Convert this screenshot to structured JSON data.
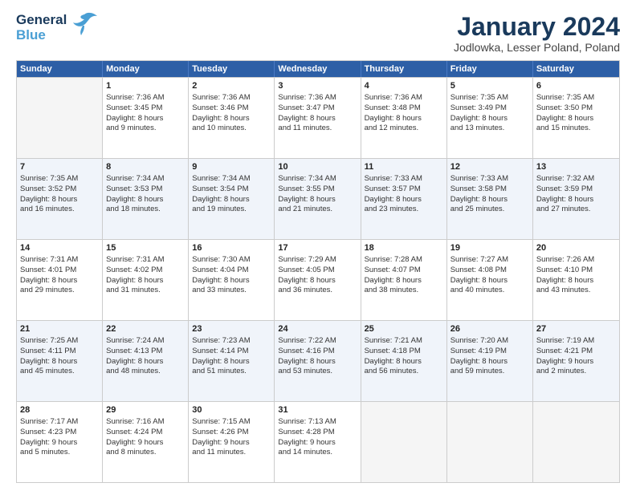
{
  "header": {
    "logo_line1": "General",
    "logo_line2": "Blue",
    "month": "January 2024",
    "location": "Jodlowka, Lesser Poland, Poland"
  },
  "days_of_week": [
    "Sunday",
    "Monday",
    "Tuesday",
    "Wednesday",
    "Thursday",
    "Friday",
    "Saturday"
  ],
  "rows": [
    [
      {
        "day": "",
        "empty": true,
        "lines": []
      },
      {
        "day": "1",
        "empty": false,
        "lines": [
          "Sunrise: 7:36 AM",
          "Sunset: 3:45 PM",
          "Daylight: 8 hours",
          "and 9 minutes."
        ]
      },
      {
        "day": "2",
        "empty": false,
        "lines": [
          "Sunrise: 7:36 AM",
          "Sunset: 3:46 PM",
          "Daylight: 8 hours",
          "and 10 minutes."
        ]
      },
      {
        "day": "3",
        "empty": false,
        "lines": [
          "Sunrise: 7:36 AM",
          "Sunset: 3:47 PM",
          "Daylight: 8 hours",
          "and 11 minutes."
        ]
      },
      {
        "day": "4",
        "empty": false,
        "lines": [
          "Sunrise: 7:36 AM",
          "Sunset: 3:48 PM",
          "Daylight: 8 hours",
          "and 12 minutes."
        ]
      },
      {
        "day": "5",
        "empty": false,
        "lines": [
          "Sunrise: 7:35 AM",
          "Sunset: 3:49 PM",
          "Daylight: 8 hours",
          "and 13 minutes."
        ]
      },
      {
        "day": "6",
        "empty": false,
        "lines": [
          "Sunrise: 7:35 AM",
          "Sunset: 3:50 PM",
          "Daylight: 8 hours",
          "and 15 minutes."
        ]
      }
    ],
    [
      {
        "day": "7",
        "empty": false,
        "lines": [
          "Sunrise: 7:35 AM",
          "Sunset: 3:52 PM",
          "Daylight: 8 hours",
          "and 16 minutes."
        ]
      },
      {
        "day": "8",
        "empty": false,
        "lines": [
          "Sunrise: 7:34 AM",
          "Sunset: 3:53 PM",
          "Daylight: 8 hours",
          "and 18 minutes."
        ]
      },
      {
        "day": "9",
        "empty": false,
        "lines": [
          "Sunrise: 7:34 AM",
          "Sunset: 3:54 PM",
          "Daylight: 8 hours",
          "and 19 minutes."
        ]
      },
      {
        "day": "10",
        "empty": false,
        "lines": [
          "Sunrise: 7:34 AM",
          "Sunset: 3:55 PM",
          "Daylight: 8 hours",
          "and 21 minutes."
        ]
      },
      {
        "day": "11",
        "empty": false,
        "lines": [
          "Sunrise: 7:33 AM",
          "Sunset: 3:57 PM",
          "Daylight: 8 hours",
          "and 23 minutes."
        ]
      },
      {
        "day": "12",
        "empty": false,
        "lines": [
          "Sunrise: 7:33 AM",
          "Sunset: 3:58 PM",
          "Daylight: 8 hours",
          "and 25 minutes."
        ]
      },
      {
        "day": "13",
        "empty": false,
        "lines": [
          "Sunrise: 7:32 AM",
          "Sunset: 3:59 PM",
          "Daylight: 8 hours",
          "and 27 minutes."
        ]
      }
    ],
    [
      {
        "day": "14",
        "empty": false,
        "lines": [
          "Sunrise: 7:31 AM",
          "Sunset: 4:01 PM",
          "Daylight: 8 hours",
          "and 29 minutes."
        ]
      },
      {
        "day": "15",
        "empty": false,
        "lines": [
          "Sunrise: 7:31 AM",
          "Sunset: 4:02 PM",
          "Daylight: 8 hours",
          "and 31 minutes."
        ]
      },
      {
        "day": "16",
        "empty": false,
        "lines": [
          "Sunrise: 7:30 AM",
          "Sunset: 4:04 PM",
          "Daylight: 8 hours",
          "and 33 minutes."
        ]
      },
      {
        "day": "17",
        "empty": false,
        "lines": [
          "Sunrise: 7:29 AM",
          "Sunset: 4:05 PM",
          "Daylight: 8 hours",
          "and 36 minutes."
        ]
      },
      {
        "day": "18",
        "empty": false,
        "lines": [
          "Sunrise: 7:28 AM",
          "Sunset: 4:07 PM",
          "Daylight: 8 hours",
          "and 38 minutes."
        ]
      },
      {
        "day": "19",
        "empty": false,
        "lines": [
          "Sunrise: 7:27 AM",
          "Sunset: 4:08 PM",
          "Daylight: 8 hours",
          "and 40 minutes."
        ]
      },
      {
        "day": "20",
        "empty": false,
        "lines": [
          "Sunrise: 7:26 AM",
          "Sunset: 4:10 PM",
          "Daylight: 8 hours",
          "and 43 minutes."
        ]
      }
    ],
    [
      {
        "day": "21",
        "empty": false,
        "lines": [
          "Sunrise: 7:25 AM",
          "Sunset: 4:11 PM",
          "Daylight: 8 hours",
          "and 45 minutes."
        ]
      },
      {
        "day": "22",
        "empty": false,
        "lines": [
          "Sunrise: 7:24 AM",
          "Sunset: 4:13 PM",
          "Daylight: 8 hours",
          "and 48 minutes."
        ]
      },
      {
        "day": "23",
        "empty": false,
        "lines": [
          "Sunrise: 7:23 AM",
          "Sunset: 4:14 PM",
          "Daylight: 8 hours",
          "and 51 minutes."
        ]
      },
      {
        "day": "24",
        "empty": false,
        "lines": [
          "Sunrise: 7:22 AM",
          "Sunset: 4:16 PM",
          "Daylight: 8 hours",
          "and 53 minutes."
        ]
      },
      {
        "day": "25",
        "empty": false,
        "lines": [
          "Sunrise: 7:21 AM",
          "Sunset: 4:18 PM",
          "Daylight: 8 hours",
          "and 56 minutes."
        ]
      },
      {
        "day": "26",
        "empty": false,
        "lines": [
          "Sunrise: 7:20 AM",
          "Sunset: 4:19 PM",
          "Daylight: 8 hours",
          "and 59 minutes."
        ]
      },
      {
        "day": "27",
        "empty": false,
        "lines": [
          "Sunrise: 7:19 AM",
          "Sunset: 4:21 PM",
          "Daylight: 9 hours",
          "and 2 minutes."
        ]
      }
    ],
    [
      {
        "day": "28",
        "empty": false,
        "lines": [
          "Sunrise: 7:17 AM",
          "Sunset: 4:23 PM",
          "Daylight: 9 hours",
          "and 5 minutes."
        ]
      },
      {
        "day": "29",
        "empty": false,
        "lines": [
          "Sunrise: 7:16 AM",
          "Sunset: 4:24 PM",
          "Daylight: 9 hours",
          "and 8 minutes."
        ]
      },
      {
        "day": "30",
        "empty": false,
        "lines": [
          "Sunrise: 7:15 AM",
          "Sunset: 4:26 PM",
          "Daylight: 9 hours",
          "and 11 minutes."
        ]
      },
      {
        "day": "31",
        "empty": false,
        "lines": [
          "Sunrise: 7:13 AM",
          "Sunset: 4:28 PM",
          "Daylight: 9 hours",
          "and 14 minutes."
        ]
      },
      {
        "day": "",
        "empty": true,
        "lines": []
      },
      {
        "day": "",
        "empty": true,
        "lines": []
      },
      {
        "day": "",
        "empty": true,
        "lines": []
      }
    ]
  ]
}
